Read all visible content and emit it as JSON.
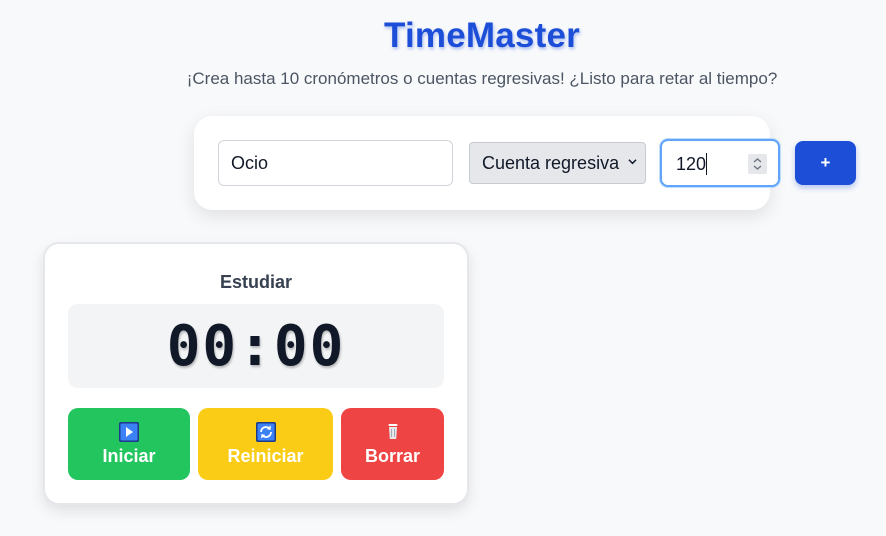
{
  "header": {
    "title": "TimeMaster",
    "subtitle": "¡Crea hasta 10 cronómetros o cuentas regresivas! ¿Listo para retar al tiempo?"
  },
  "form": {
    "name_value": "Ocio",
    "type_selected": "Cuenta regresiva",
    "seconds_value": "120",
    "add_label": "+"
  },
  "timer": {
    "name": "Estudiar",
    "display": "00:00",
    "start_label": "Iniciar",
    "reset_label": "Reiniciar",
    "delete_label": "Borrar",
    "start_icon": "play-icon",
    "reset_icon": "refresh-icon",
    "delete_icon": "trash-icon"
  },
  "colors": {
    "accent": "#1d4ed8",
    "start": "#22c55e",
    "reset": "#facc15",
    "delete": "#ef4444"
  }
}
